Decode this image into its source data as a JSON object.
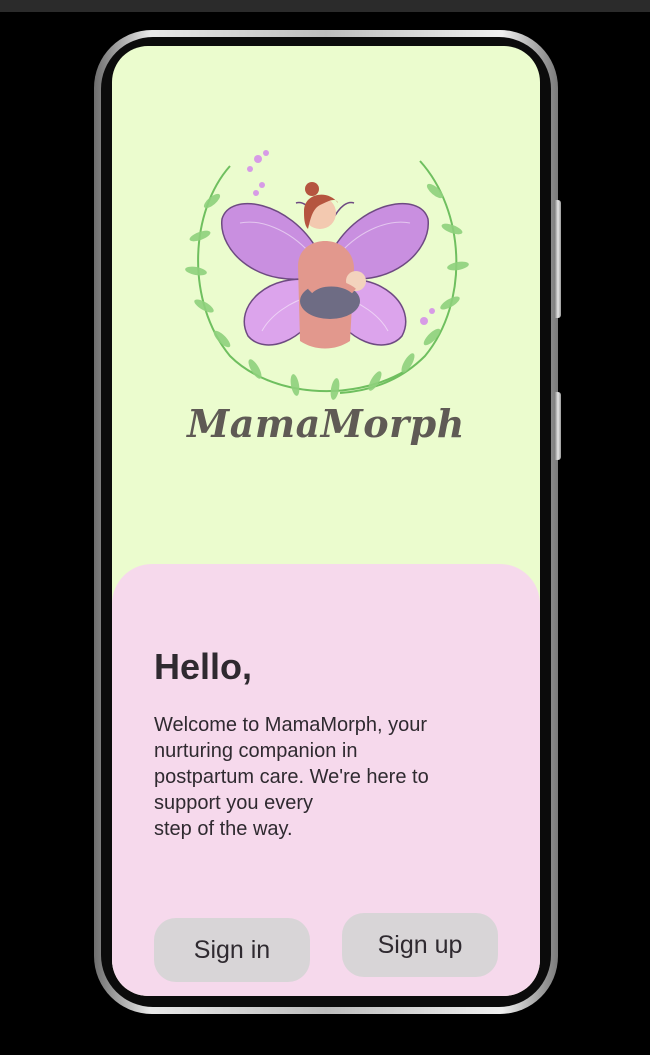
{
  "app": {
    "name": "MamaMorph"
  },
  "welcome_card": {
    "greeting": "Hello,",
    "message_lines": [
      "Welcome to MamaMorph, your",
      "nurturing companion in",
      "postpartum care. We're here to",
      "support you every",
      "step of the way."
    ]
  },
  "actions": {
    "sign_in_label": "Sign in",
    "sign_up_label": "Sign up"
  },
  "colors": {
    "screen_background": "#ebfcce",
    "card_background": "#f6d9ec",
    "button_background": "#d8d5d7",
    "text": "#2f2a30",
    "brand_text": "#5f5a55",
    "wing_purple": "#c98fe0",
    "leaf_green": "#7cc46b"
  },
  "icons": {
    "logo": "butterfly-mother-baby-logo"
  }
}
